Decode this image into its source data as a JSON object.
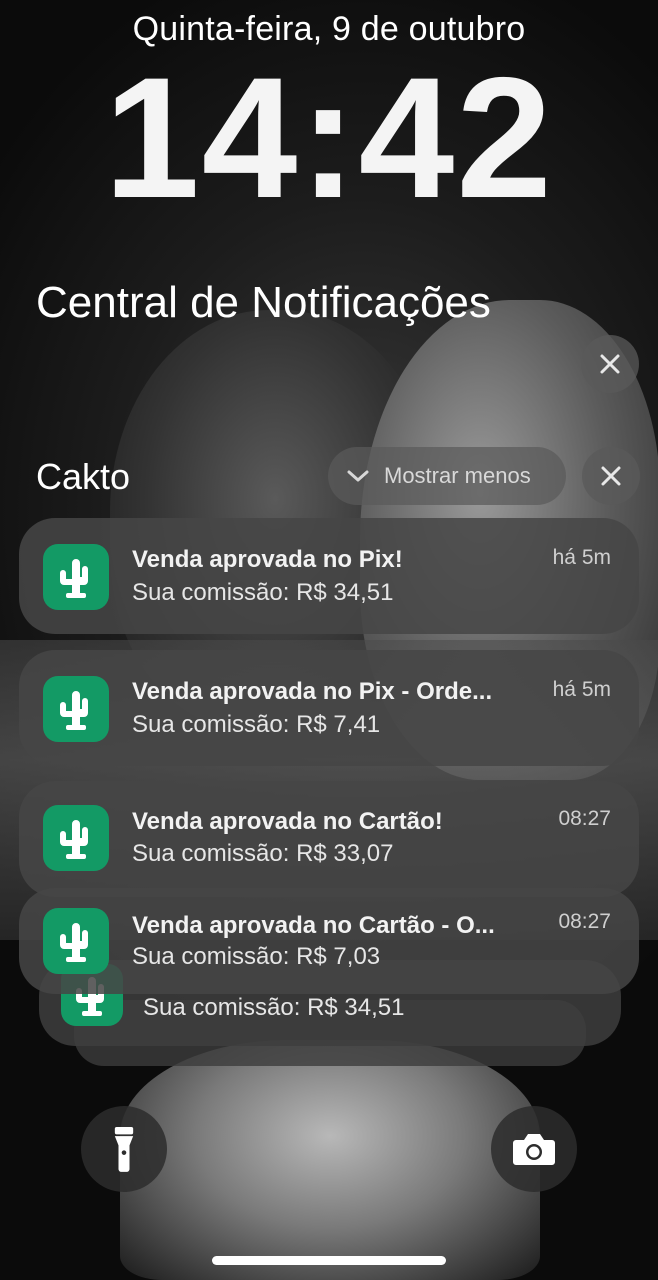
{
  "lock_screen": {
    "date": "Quinta-feira, 9 de outubro",
    "time": "14:42"
  },
  "notification_center": {
    "title": "Central de Notificações"
  },
  "group": {
    "app_name": "Cakto",
    "show_less_label": "Mostrar menos"
  },
  "notifications": [
    {
      "title": "Venda aprovada no Pix!",
      "body": "Sua comissão: R$ 34,51",
      "time": "há 5m"
    },
    {
      "title": "Venda aprovada no Pix - Orde...",
      "body": "Sua comissão: R$ 7,41",
      "time": "há 5m"
    },
    {
      "title": "Venda aprovada no Cartão!",
      "body": "Sua comissão: R$ 33,07",
      "time": "08:27"
    },
    {
      "title": "Venda aprovada no Cartão - O...",
      "body": "Sua comissão: R$ 7,03",
      "time": "08:27"
    },
    {
      "title": "",
      "body": "Sua comissão: R$ 34,51",
      "time": ""
    }
  ],
  "icons": {
    "app": "cactus-icon",
    "close": "close-icon",
    "chevron": "chevron-down-icon",
    "flashlight": "flashlight-icon",
    "camera": "camera-icon"
  },
  "colors": {
    "app_icon_bg": "#139a65",
    "card_bg": "#464646"
  }
}
